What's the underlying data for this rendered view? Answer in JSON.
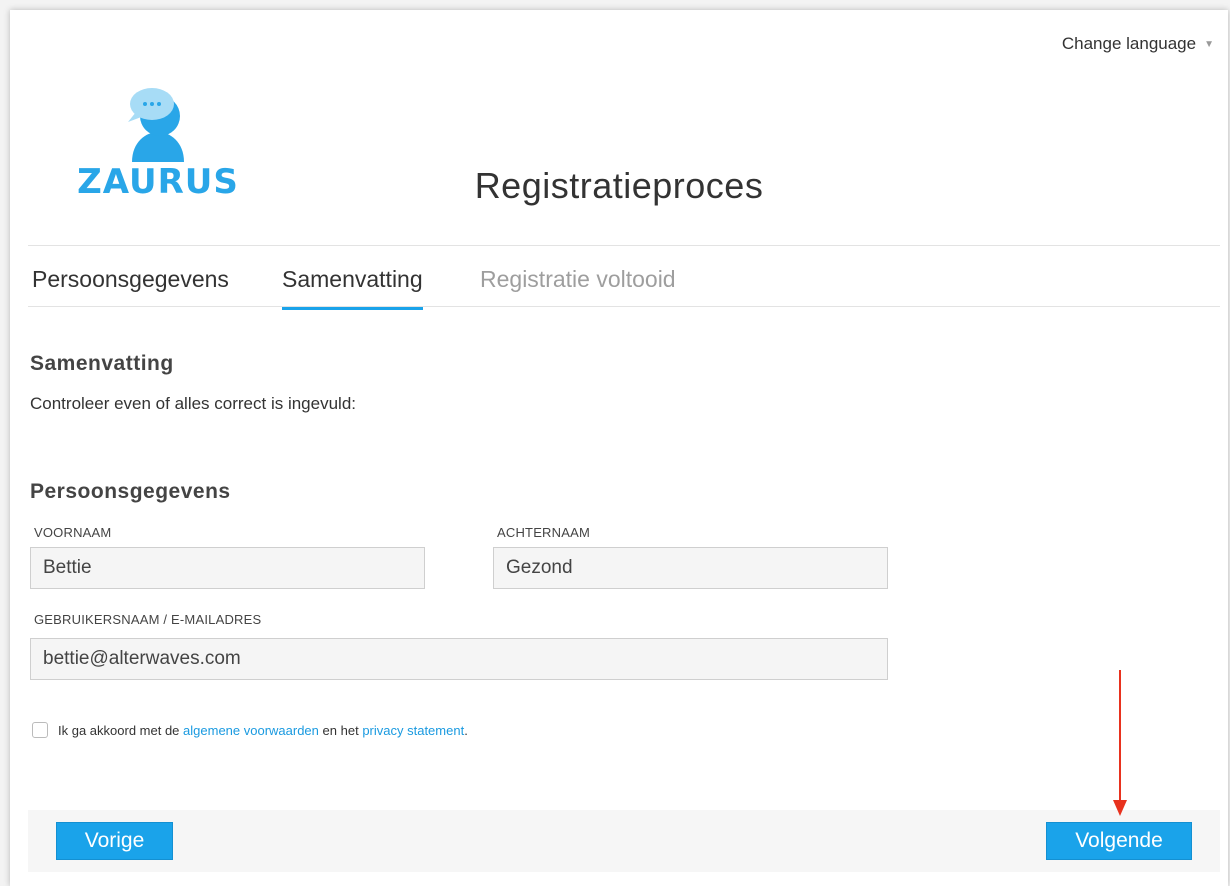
{
  "header": {
    "change_language": "Change language",
    "logo_text": "ZAURUS",
    "title": "Registratieproces"
  },
  "tabs": [
    {
      "label": "Persoonsgegevens",
      "state": "done"
    },
    {
      "label": "Samenvatting",
      "state": "active"
    },
    {
      "label": "Registratie voltooid",
      "state": "disabled"
    }
  ],
  "summary": {
    "title": "Samenvatting",
    "description": "Controleer even of alles correct is ingevuld:"
  },
  "personal": {
    "title": "Persoonsgegevens",
    "first_name_label": "VOORNAAM",
    "first_name_value": "Bettie",
    "last_name_label": "ACHTERNAAM",
    "last_name_value": "Gezond",
    "username_label": "GEBRUIKERSNAAM / E-MAILADRES",
    "username_value": "bettie@alterwaves.com"
  },
  "agreement": {
    "text_before": "Ik ga akkoord met de",
    "terms_link": "algemene voorwaarden",
    "text_middle": "en het",
    "privacy_link": "privacy statement",
    "text_after": ".",
    "checked": false
  },
  "footer": {
    "prev_label": "Vorige",
    "next_label": "Volgende"
  },
  "colors": {
    "accent": "#1aa3ea",
    "annotation_arrow": "#e8321e"
  }
}
